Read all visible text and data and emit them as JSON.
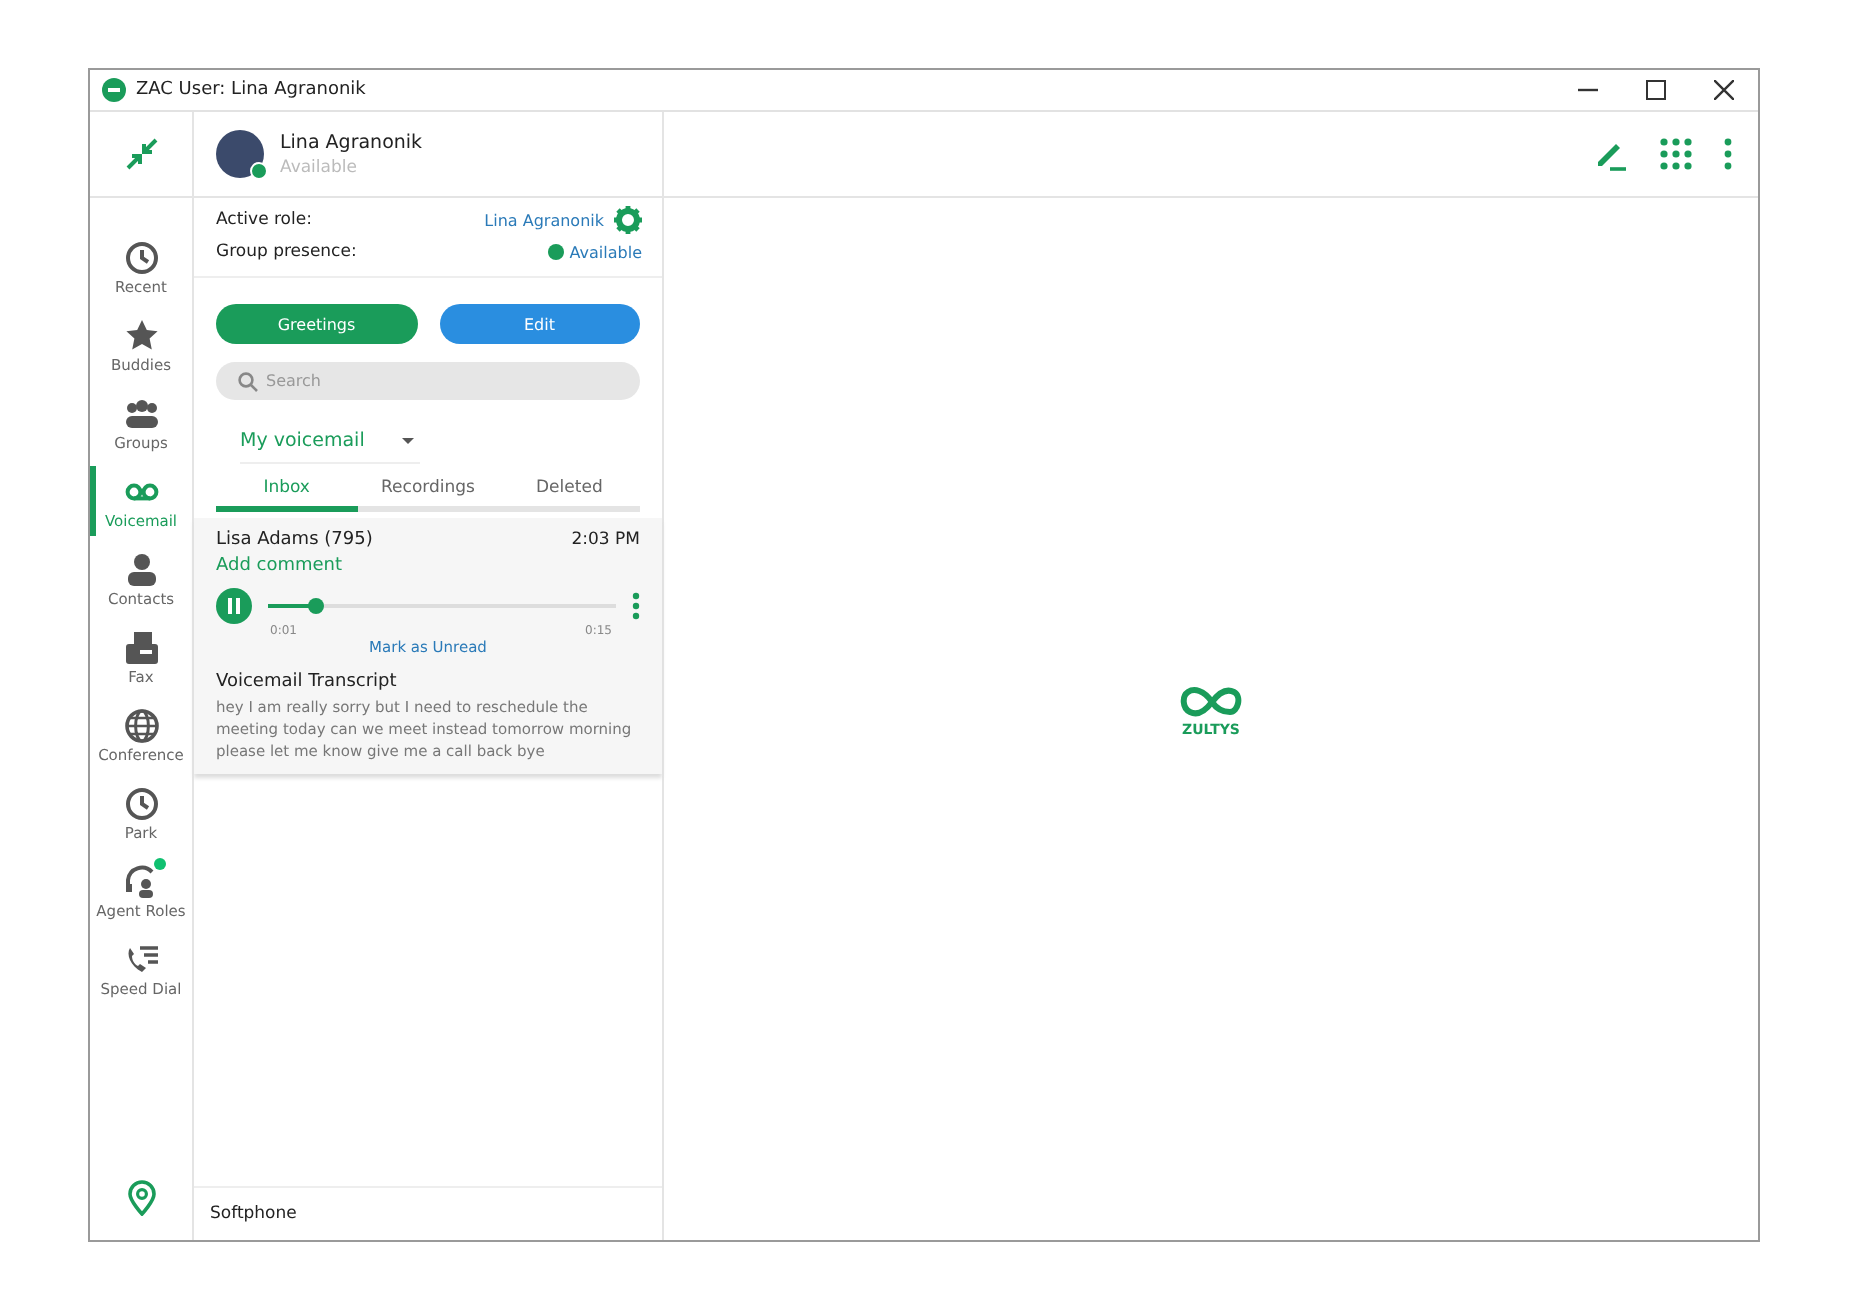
{
  "window": {
    "title": "ZAC User: Lina Agranonik"
  },
  "user": {
    "name": "Lina Agranonik",
    "status": "Available"
  },
  "nav": [
    {
      "kind": "recent",
      "label": "Recent",
      "selected": false,
      "badge": false
    },
    {
      "kind": "buddies",
      "label": "Buddies",
      "selected": false,
      "badge": false
    },
    {
      "kind": "groups",
      "label": "Groups",
      "selected": false,
      "badge": false
    },
    {
      "kind": "voicemail",
      "label": "Voicemail",
      "selected": true,
      "badge": false
    },
    {
      "kind": "contacts",
      "label": "Contacts",
      "selected": false,
      "badge": false
    },
    {
      "kind": "fax",
      "label": "Fax",
      "selected": false,
      "badge": false
    },
    {
      "kind": "conference",
      "label": "Conference",
      "selected": false,
      "badge": false
    },
    {
      "kind": "park",
      "label": "Park",
      "selected": false,
      "badge": false
    },
    {
      "kind": "agent",
      "label": "Agent Roles",
      "selected": false,
      "badge": true
    },
    {
      "kind": "speed",
      "label": "Speed Dial",
      "selected": false,
      "badge": false
    }
  ],
  "roles": {
    "active_role_label": "Active role:",
    "active_role": "Lina Agranonik",
    "presence_label": "Group presence:",
    "presence": "Available"
  },
  "buttons": [
    {
      "kind": "primary",
      "label": "Greetings"
    },
    {
      "kind": "secondary",
      "label": "Edit"
    }
  ],
  "search": {
    "placeholder": "Search"
  },
  "mailbox": {
    "value": "My voicemail"
  },
  "tabs": [
    {
      "label": "Inbox",
      "selected": true
    },
    {
      "label": "Recordings",
      "selected": false
    },
    {
      "label": "Deleted",
      "selected": false
    }
  ],
  "voicemail": {
    "caller": "Lisa Adams (795)",
    "time": "2:03 PM",
    "comment": "Add comment",
    "playing": true,
    "level": 0.14,
    "elapsed": "0:01",
    "total": "0:15",
    "mark": "Mark as Unread",
    "transcript_title": "Voicemail Transcript",
    "transcript": "hey I am really sorry but I need to reschedule the meeting today can we meet instead tomorrow morning please let me know give me a call back bye"
  },
  "footer": "Softphone",
  "logo": {
    "text": "ZULTYS"
  }
}
